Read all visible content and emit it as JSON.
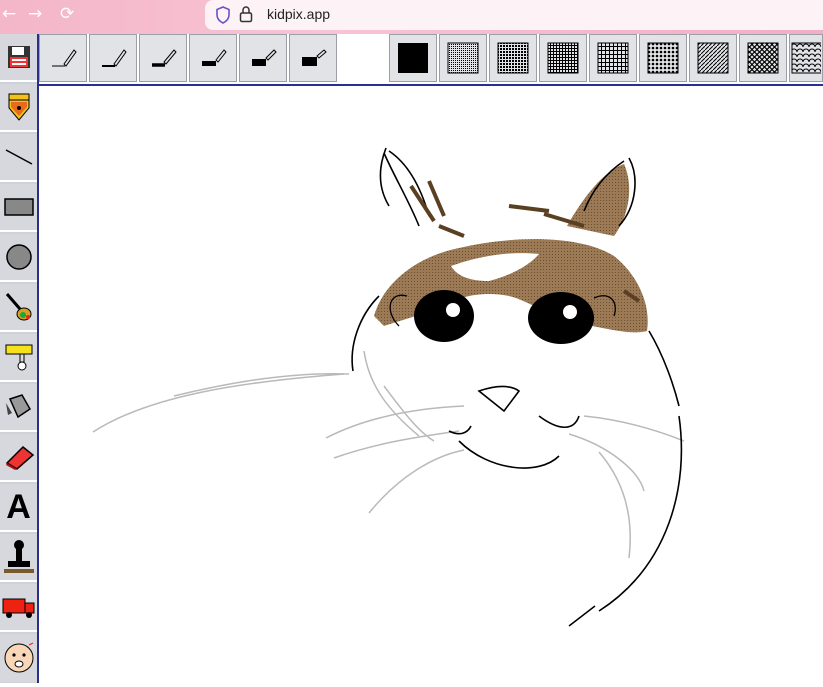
{
  "browser": {
    "url": "kidpix.app",
    "back_icon": "arrow-left-icon",
    "forward_icon": "arrow-right-icon",
    "reload_icon": "reload-icon"
  },
  "kidpix": {
    "tools": [
      {
        "name": "save-tool",
        "icon": "floppy-disk-icon"
      },
      {
        "name": "pencil-tool",
        "icon": "pencil-icon"
      },
      {
        "name": "line-tool",
        "icon": "line-icon"
      },
      {
        "name": "rectangle-tool",
        "icon": "rectangle-icon"
      },
      {
        "name": "oval-tool",
        "icon": "circle-icon"
      },
      {
        "name": "wacky-brush-tool",
        "icon": "brush-icon"
      },
      {
        "name": "electric-mixer-tool",
        "icon": "mixer-icon"
      },
      {
        "name": "paint-bucket-tool",
        "icon": "paint-bucket-icon"
      },
      {
        "name": "eraser-tool",
        "icon": "eraser-icon"
      },
      {
        "name": "text-tool",
        "icon": "letter-a-icon"
      },
      {
        "name": "stamp-tool",
        "icon": "stamp-icon"
      },
      {
        "name": "truck-tool",
        "icon": "truck-icon"
      },
      {
        "name": "undo-guy-tool",
        "icon": "face-icon"
      }
    ],
    "text_tool_letter": "A",
    "brush_sizes": [
      "size-1",
      "size-2",
      "size-3",
      "size-4",
      "size-5",
      "size-6"
    ],
    "patterns": [
      "solid-black",
      "dense-dots",
      "checker",
      "fine-grid",
      "grid",
      "coarse-dots",
      "diagonal-lines",
      "diamond",
      "scales"
    ],
    "colors": {
      "toolbar_border": "#2a2f8c",
      "cat_brown": "#8a6a4a",
      "browser_pink": "#f4b6c9"
    }
  }
}
